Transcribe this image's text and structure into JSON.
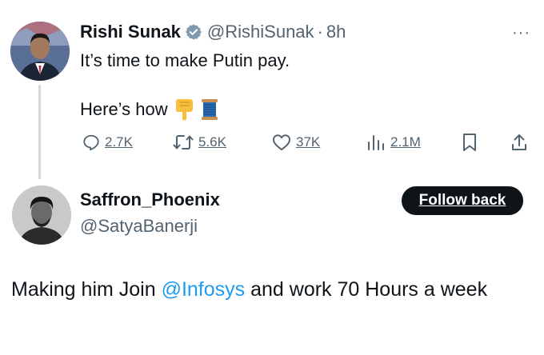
{
  "tweet": {
    "author_name": "Rishi Sunak",
    "author_handle": "@RishiSunak",
    "separator": "·",
    "time": "8h",
    "line1": "It’s time to make Putin pay.",
    "line2": "Here’s how",
    "emojis": [
      "pointing-down-emoji",
      "thread-spool-emoji"
    ],
    "stats": {
      "replies": "2.7K",
      "reposts": "5.6K",
      "likes": "37K",
      "views": "2.1M"
    },
    "more_label": "···"
  },
  "reply": {
    "author_name": "Saffron_Phoenix",
    "author_handle": "@SatyaBanerji",
    "follow_button": "Follow back",
    "text_before": "Making him Join ",
    "mention": "@Infosys",
    "text_after": " and work 70 Hours a week"
  },
  "colors": {
    "text": "#0f1419",
    "secondary": "#536471",
    "accent": "#1d9bf0",
    "verified": "#829aab"
  }
}
